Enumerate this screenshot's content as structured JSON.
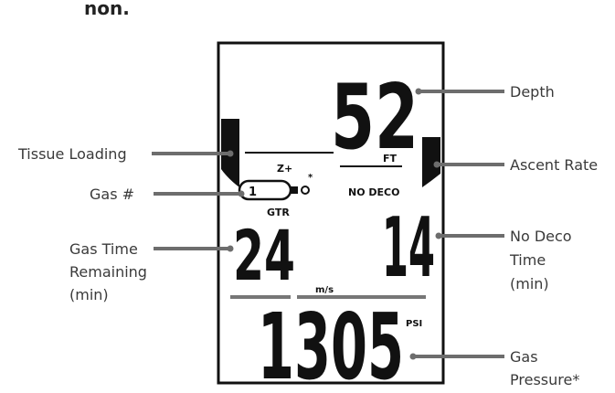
{
  "header_fragment": "non.",
  "display": {
    "depth": "52",
    "depth_unit": "FT",
    "gas_mode": "Z+",
    "gas_number": "1",
    "gas_marker": "*",
    "gtr_label": "GTR",
    "gtr_value": "24",
    "ndl_label": "NO DECO",
    "ndl_value": "14",
    "rate_unit": "m/s",
    "pressure": "1305",
    "pressure_unit": "PSI"
  },
  "callouts": {
    "depth": "Depth",
    "tissue_loading": "Tissue Loading",
    "ascent_rate": "Ascent Rate",
    "gas_number": "Gas #",
    "gtr_line1": "Gas Time",
    "gtr_line2": "Remaining",
    "gtr_line3": "(min)",
    "ndl_line1": "No Deco",
    "ndl_line2": "Time",
    "ndl_line3": "(min)",
    "pressure_line1": "Gas",
    "pressure_line2": "Pressure*"
  },
  "colors": {
    "lcd_ink": "#111111",
    "callout_text": "#3a3a3a",
    "leader": "#6d6d6d"
  }
}
